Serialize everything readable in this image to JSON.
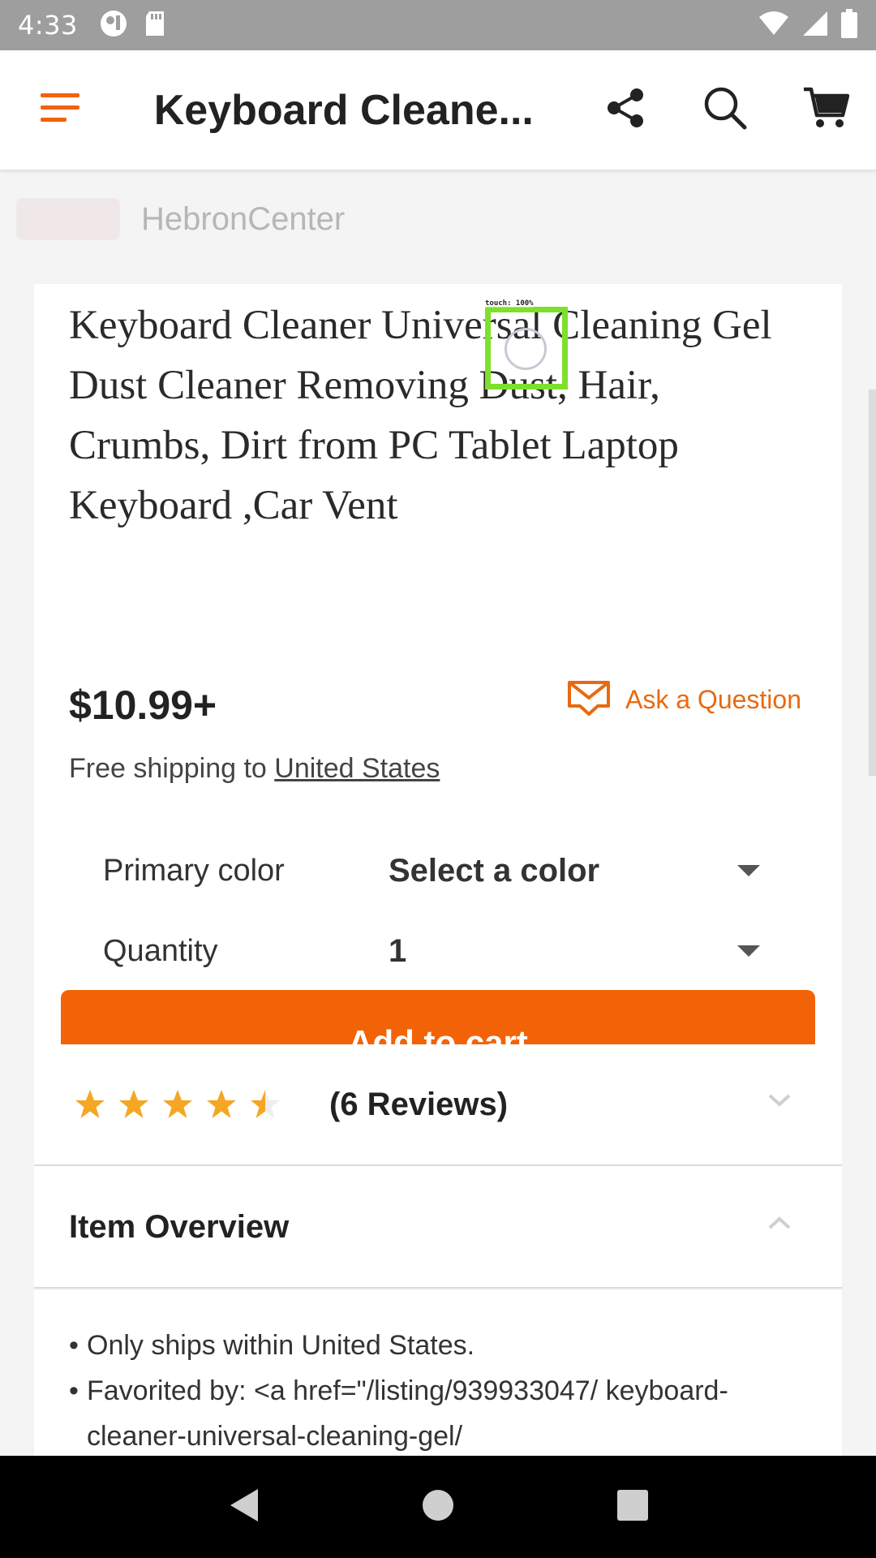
{
  "status_bar": {
    "time": "4:33"
  },
  "app_bar": {
    "title": "Keyboard Cleane..."
  },
  "shop": {
    "name": "HebronCenter"
  },
  "listing": {
    "title": "Keyboard Cleaner Universal Cleaning Gel Dust Cleaner Removing Dust, Hair, Crumbs, Dirt from PC Tablet Laptop Keyboard ,Car Vent",
    "price": "$10.99+",
    "ask_label": "Ask a Question",
    "shipping_prefix": "Free shipping to ",
    "shipping_country": "United States",
    "options": [
      {
        "label": "Primary color",
        "value": "Select a color"
      },
      {
        "label": "Quantity",
        "value": "1"
      }
    ],
    "add_to_cart": "Add to cart"
  },
  "reviews": {
    "rating": 4.5,
    "max_rating": 5,
    "count_label": "(6 Reviews)"
  },
  "overview": {
    "title": "Item Overview",
    "bullets": [
      "Only ships within United States.",
      "Favorited by: <a href=\"/listing/939933047/ keyboard-cleaner-universal-cleaning-gel/"
    ]
  },
  "touch_indicator": {
    "label": "touch: 100%"
  },
  "colors": {
    "accent": "#f26308",
    "link_accent": "#e86a10",
    "star": "#f5a623"
  }
}
